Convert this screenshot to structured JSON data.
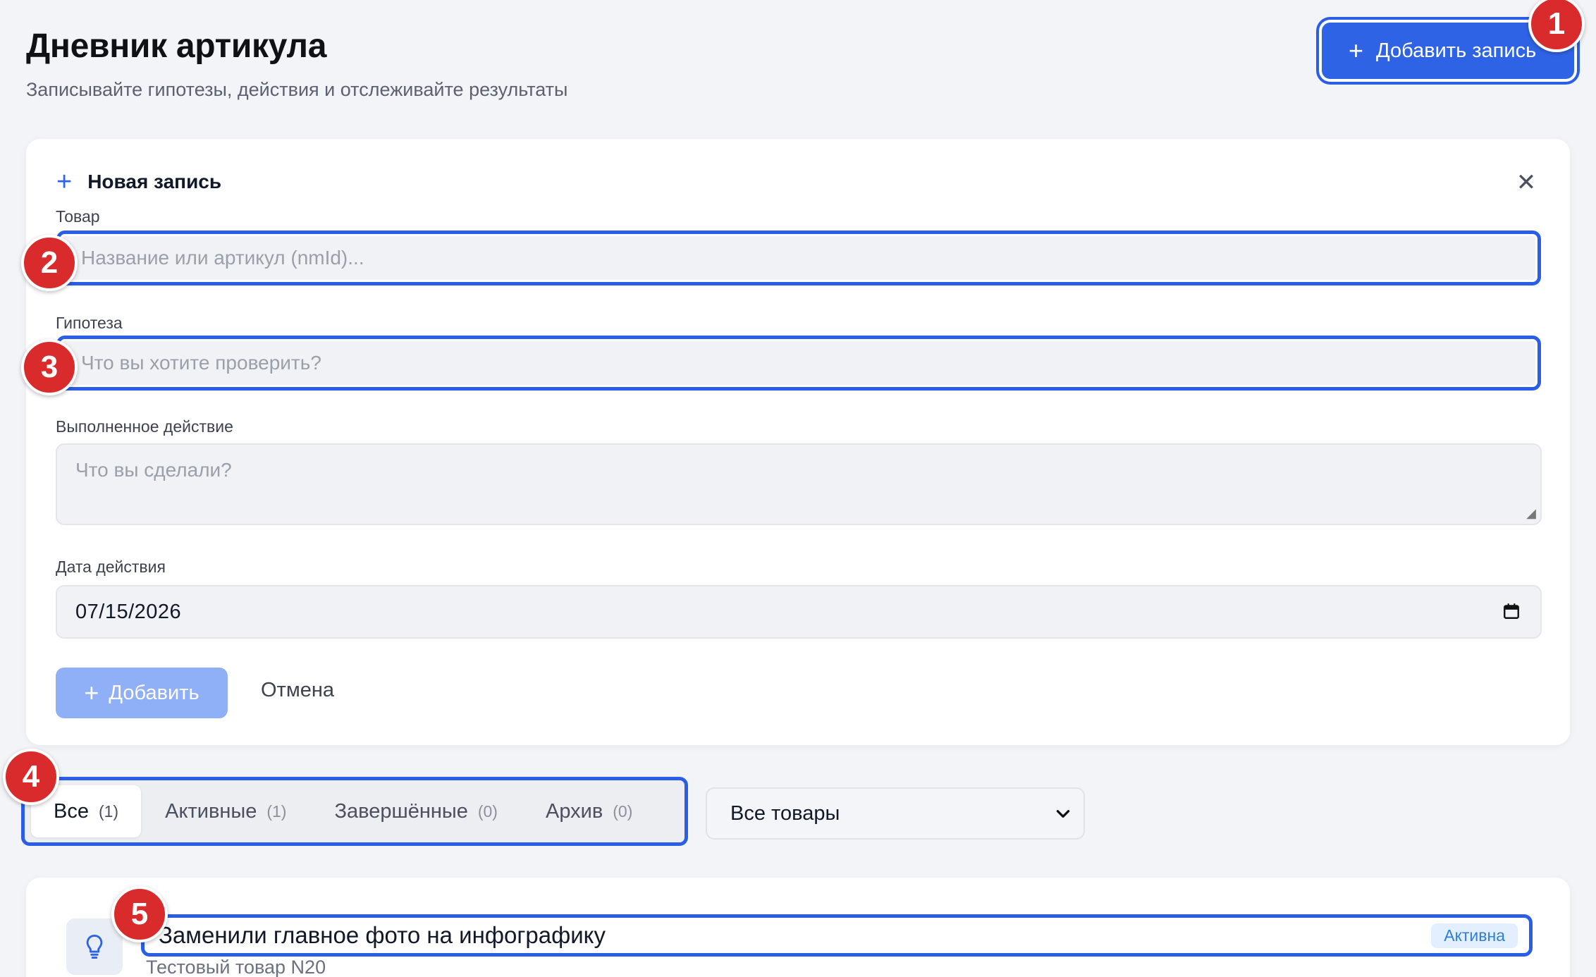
{
  "header": {
    "title": "Дневник артикула",
    "subtitle": "Записывайте гипотезы, действия и отслеживайте результаты",
    "add_button_label": "Добавить запись"
  },
  "form": {
    "title": "Новая запись",
    "product": {
      "label": "Товар",
      "placeholder": "Название или артикул (nmId)..."
    },
    "hypothesis": {
      "label": "Гипотеза",
      "placeholder": "Что вы хотите проверить?"
    },
    "action": {
      "label": "Выполненное действие",
      "placeholder": "Что вы сделали?"
    },
    "date": {
      "label": "Дата действия",
      "value": "07/15/2026"
    },
    "submit_label": "Добавить",
    "cancel_label": "Отмена"
  },
  "filters": {
    "tabs": [
      {
        "label": "Все",
        "count": "(1)"
      },
      {
        "label": "Активные",
        "count": "(1)"
      },
      {
        "label": "Завершённые",
        "count": "(0)"
      },
      {
        "label": "Архив",
        "count": "(0)"
      }
    ],
    "product_select": "Все товары"
  },
  "entries": [
    {
      "title": "Заменили главное фото на инфографику",
      "status": "Активна",
      "product": "Тестовый товар N20"
    }
  ],
  "badges": [
    "1",
    "2",
    "3",
    "4",
    "5"
  ],
  "colors": {
    "accent": "#2f63e6",
    "highlight": "#2a5ee6",
    "badge": "#d92b2b",
    "disabled_button": "#8fb0f6",
    "status_bg": "#e3efff",
    "status_text": "#2f7fd6"
  },
  "icons": {
    "add": "plus-icon",
    "close": "close-icon",
    "calendar": "calendar-icon",
    "chevron": "chevron-down-icon",
    "entry": "lightbulb-icon"
  }
}
